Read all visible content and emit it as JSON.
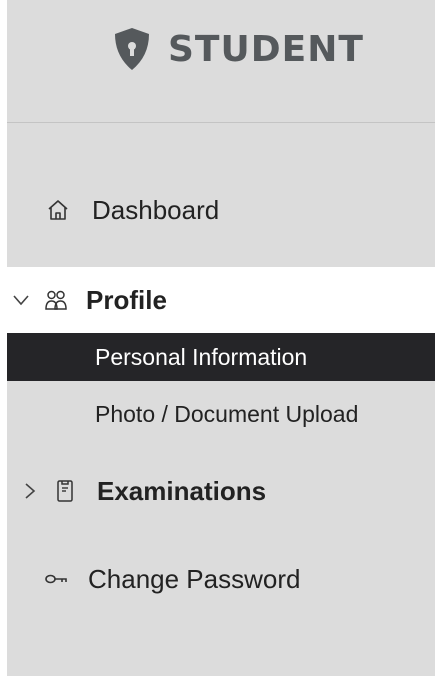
{
  "brand": {
    "title": "STUDENT",
    "icon": "shield-icon",
    "color": "#55595c"
  },
  "nav": {
    "dashboard": {
      "label": "Dashboard",
      "icon": "home-icon"
    },
    "profile": {
      "label": "Profile",
      "icon": "users-icon",
      "expanded": true,
      "children": [
        {
          "label": "Personal Information",
          "active": true
        },
        {
          "label": "Photo / Document Upload",
          "active": false
        }
      ]
    },
    "examinations": {
      "label": "Examinations",
      "icon": "clipboard-icon",
      "expanded": false
    },
    "change_password": {
      "label": "Change Password",
      "icon": "key-icon"
    }
  },
  "colors": {
    "sidebar_bg": "#dcdcdc",
    "active_bg": "#252528",
    "active_text": "#ffffff",
    "open_section_bg": "#ffffff"
  }
}
